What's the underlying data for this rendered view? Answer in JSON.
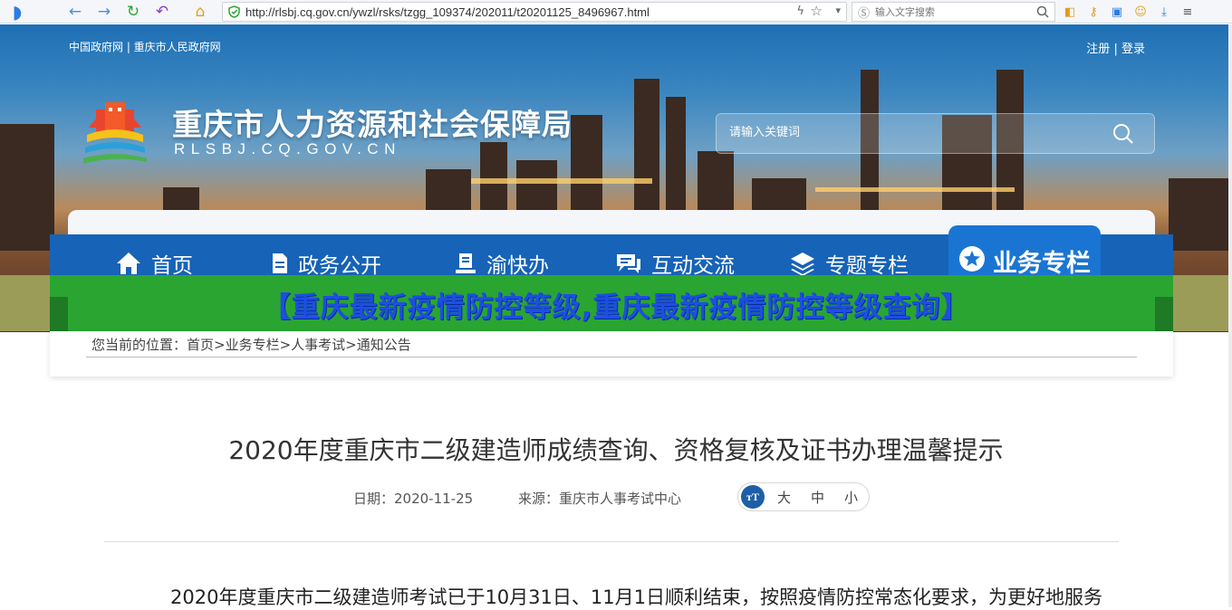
{
  "browser": {
    "url": "http://rlsbj.cq.gov.cn/ywzl/rsks/tzgg_109374/202011/t20201125_8496967.html",
    "search_placeholder": "输入文字搜索"
  },
  "header": {
    "top_links": "中国政府网 | 重庆市人民政府网",
    "register": "注册",
    "sep": "|",
    "login": "登录",
    "site_title": "重庆市人力资源和社会保障局",
    "site_subtitle": "RLSBJ.CQ.GOV.CN",
    "search_placeholder": "请输入关键词"
  },
  "nav": {
    "items": [
      {
        "label": "首页",
        "icon": "home-icon"
      },
      {
        "label": "政务公开",
        "icon": "document-icon"
      },
      {
        "label": "渝快办",
        "icon": "office-icon"
      },
      {
        "label": "互动交流",
        "icon": "chat-icon"
      },
      {
        "label": "专题专栏",
        "icon": "layers-icon"
      }
    ],
    "active": {
      "label": "业务专栏",
      "icon": "star-icon"
    }
  },
  "banner": {
    "text": "【重庆最新疫情防控等级,重庆最新疫情防控等级查询】"
  },
  "breadcrumb": {
    "text": "您当前的位置：首页>业务专栏>人事考试>通知公告"
  },
  "article": {
    "title": "2020年度重庆市二级建造师成绩查询、资格复核及证书办理温馨提示",
    "date_label": "日期：2020-11-25",
    "source_label": "来源：重庆市人事考试中心",
    "font_icon_label": "тT",
    "font_large": "大",
    "font_medium": "中",
    "font_small": "小",
    "body_first_line": "2020年度重庆市二级建造师考试已于10月31日、11月1日顺利结束，按照疫情防控常态化要求，为更好地服务"
  },
  "colors": {
    "nav_blue": "#1663b7",
    "banner_green": "#2aa532",
    "banner_text": "#1d4fe0"
  }
}
